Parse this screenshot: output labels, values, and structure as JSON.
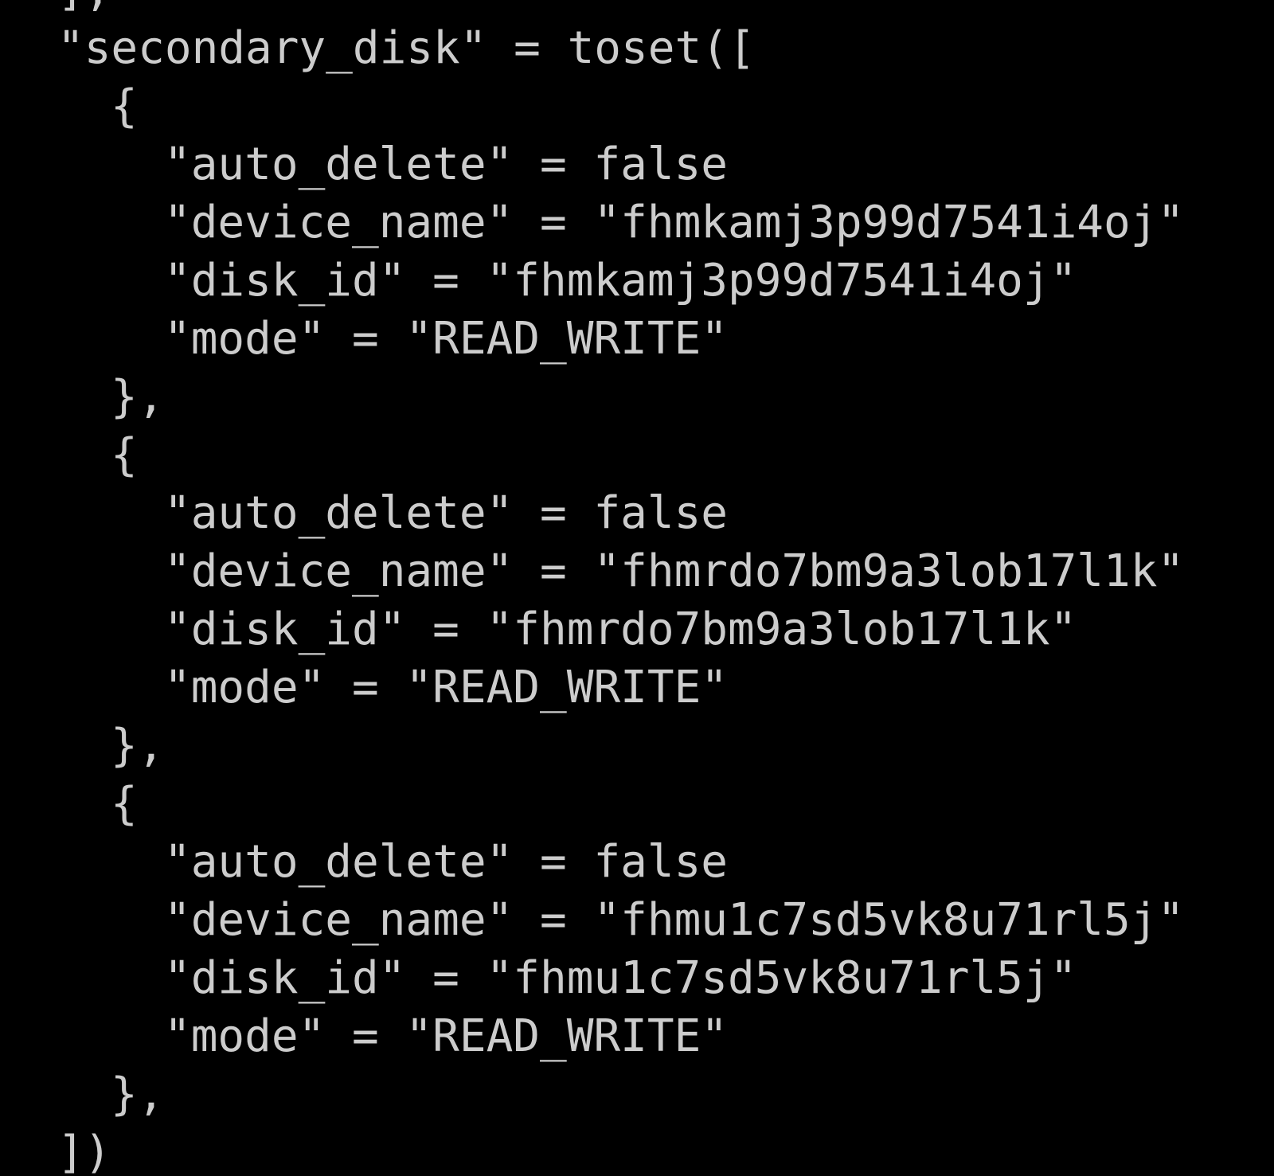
{
  "terminal": {
    "foreground": "#cccccc",
    "background": "#000000",
    "lines": [
      {
        "indent": 1,
        "text": "],"
      },
      {
        "indent": 1,
        "text": "\"secondary_disk\" = toset(["
      },
      {
        "indent": 2,
        "text": "{"
      },
      {
        "indent": 3,
        "text": "\"auto_delete\" = false"
      },
      {
        "indent": 3,
        "text": "\"device_name\" = \"fhmkamj3p99d7541i4oj\""
      },
      {
        "indent": 3,
        "text": "\"disk_id\" = \"fhmkamj3p99d7541i4oj\""
      },
      {
        "indent": 3,
        "text": "\"mode\" = \"READ_WRITE\""
      },
      {
        "indent": 2,
        "text": "},"
      },
      {
        "indent": 2,
        "text": "{"
      },
      {
        "indent": 3,
        "text": "\"auto_delete\" = false"
      },
      {
        "indent": 3,
        "text": "\"device_name\" = \"fhmrdo7bm9a3lob17l1k\""
      },
      {
        "indent": 3,
        "text": "\"disk_id\" = \"fhmrdo7bm9a3lob17l1k\""
      },
      {
        "indent": 3,
        "text": "\"mode\" = \"READ_WRITE\""
      },
      {
        "indent": 2,
        "text": "},"
      },
      {
        "indent": 2,
        "text": "{"
      },
      {
        "indent": 3,
        "text": "\"auto_delete\" = false"
      },
      {
        "indent": 3,
        "text": "\"device_name\" = \"fhmu1c7sd5vk8u71rl5j\""
      },
      {
        "indent": 3,
        "text": "\"disk_id\" = \"fhmu1c7sd5vk8u71rl5j\""
      },
      {
        "indent": 3,
        "text": "\"mode\" = \"READ_WRITE\""
      },
      {
        "indent": 2,
        "text": "},"
      },
      {
        "indent": 1,
        "text": "])"
      }
    ]
  }
}
